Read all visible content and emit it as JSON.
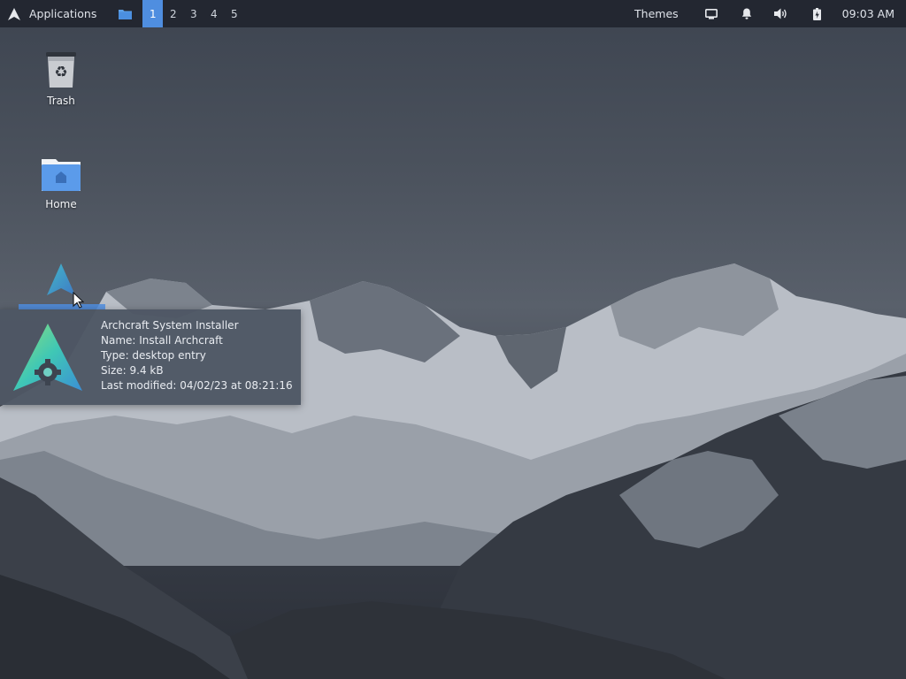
{
  "panel": {
    "app_menu_label": "Applications",
    "workspaces": [
      "1",
      "2",
      "3",
      "4",
      "5"
    ],
    "active_workspace": "1",
    "themes_label": "Themes",
    "clock": "09:03 AM"
  },
  "desktop": {
    "icons": {
      "trash": "Trash",
      "home": "Home",
      "installer": ""
    }
  },
  "tooltip": {
    "title": "Archcraft System Installer",
    "name": "Name: Install Archcraft",
    "type": "Type: desktop entry",
    "size": "Size: 9.4 kB",
    "modified": "Last modified: 04/02/23 at 08:21:16"
  },
  "colors": {
    "panel_bg": "#232731",
    "accent": "#4f8ee0",
    "tooltip_bg": "#4e5664"
  }
}
